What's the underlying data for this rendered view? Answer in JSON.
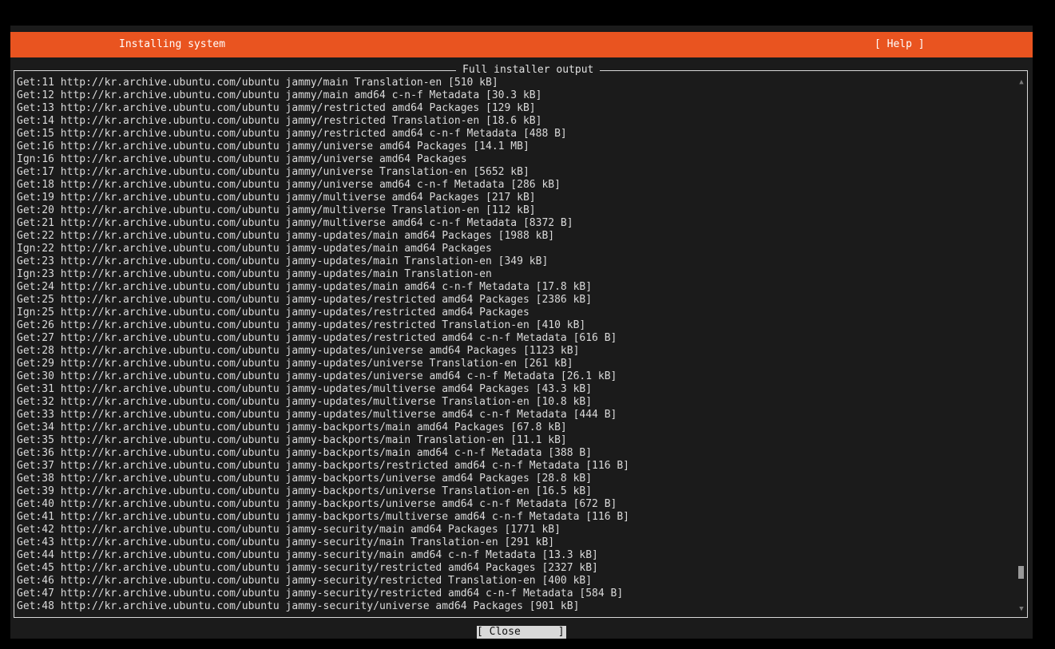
{
  "header": {
    "title": "Installing system",
    "help_label": "[ Help ]"
  },
  "output_panel": {
    "title": "Full installer output",
    "lines": [
      "Get:11 http://kr.archive.ubuntu.com/ubuntu jammy/main Translation-en [510 kB]",
      "Get:12 http://kr.archive.ubuntu.com/ubuntu jammy/main amd64 c-n-f Metadata [30.3 kB]",
      "Get:13 http://kr.archive.ubuntu.com/ubuntu jammy/restricted amd64 Packages [129 kB]",
      "Get:14 http://kr.archive.ubuntu.com/ubuntu jammy/restricted Translation-en [18.6 kB]",
      "Get:15 http://kr.archive.ubuntu.com/ubuntu jammy/restricted amd64 c-n-f Metadata [488 B]",
      "Get:16 http://kr.archive.ubuntu.com/ubuntu jammy/universe amd64 Packages [14.1 MB]",
      "Ign:16 http://kr.archive.ubuntu.com/ubuntu jammy/universe amd64 Packages",
      "Get:17 http://kr.archive.ubuntu.com/ubuntu jammy/universe Translation-en [5652 kB]",
      "Get:18 http://kr.archive.ubuntu.com/ubuntu jammy/universe amd64 c-n-f Metadata [286 kB]",
      "Get:19 http://kr.archive.ubuntu.com/ubuntu jammy/multiverse amd64 Packages [217 kB]",
      "Get:20 http://kr.archive.ubuntu.com/ubuntu jammy/multiverse Translation-en [112 kB]",
      "Get:21 http://kr.archive.ubuntu.com/ubuntu jammy/multiverse amd64 c-n-f Metadata [8372 B]",
      "Get:22 http://kr.archive.ubuntu.com/ubuntu jammy-updates/main amd64 Packages [1988 kB]",
      "Ign:22 http://kr.archive.ubuntu.com/ubuntu jammy-updates/main amd64 Packages",
      "Get:23 http://kr.archive.ubuntu.com/ubuntu jammy-updates/main Translation-en [349 kB]",
      "Ign:23 http://kr.archive.ubuntu.com/ubuntu jammy-updates/main Translation-en",
      "Get:24 http://kr.archive.ubuntu.com/ubuntu jammy-updates/main amd64 c-n-f Metadata [17.8 kB]",
      "Get:25 http://kr.archive.ubuntu.com/ubuntu jammy-updates/restricted amd64 Packages [2386 kB]",
      "Ign:25 http://kr.archive.ubuntu.com/ubuntu jammy-updates/restricted amd64 Packages",
      "Get:26 http://kr.archive.ubuntu.com/ubuntu jammy-updates/restricted Translation-en [410 kB]",
      "Get:27 http://kr.archive.ubuntu.com/ubuntu jammy-updates/restricted amd64 c-n-f Metadata [616 B]",
      "Get:28 http://kr.archive.ubuntu.com/ubuntu jammy-updates/universe amd64 Packages [1123 kB]",
      "Get:29 http://kr.archive.ubuntu.com/ubuntu jammy-updates/universe Translation-en [261 kB]",
      "Get:30 http://kr.archive.ubuntu.com/ubuntu jammy-updates/universe amd64 c-n-f Metadata [26.1 kB]",
      "Get:31 http://kr.archive.ubuntu.com/ubuntu jammy-updates/multiverse amd64 Packages [43.3 kB]",
      "Get:32 http://kr.archive.ubuntu.com/ubuntu jammy-updates/multiverse Translation-en [10.8 kB]",
      "Get:33 http://kr.archive.ubuntu.com/ubuntu jammy-updates/multiverse amd64 c-n-f Metadata [444 B]",
      "Get:34 http://kr.archive.ubuntu.com/ubuntu jammy-backports/main amd64 Packages [67.8 kB]",
      "Get:35 http://kr.archive.ubuntu.com/ubuntu jammy-backports/main Translation-en [11.1 kB]",
      "Get:36 http://kr.archive.ubuntu.com/ubuntu jammy-backports/main amd64 c-n-f Metadata [388 B]",
      "Get:37 http://kr.archive.ubuntu.com/ubuntu jammy-backports/restricted amd64 c-n-f Metadata [116 B]",
      "Get:38 http://kr.archive.ubuntu.com/ubuntu jammy-backports/universe amd64 Packages [28.8 kB]",
      "Get:39 http://kr.archive.ubuntu.com/ubuntu jammy-backports/universe Translation-en [16.5 kB]",
      "Get:40 http://kr.archive.ubuntu.com/ubuntu jammy-backports/universe amd64 c-n-f Metadata [672 B]",
      "Get:41 http://kr.archive.ubuntu.com/ubuntu jammy-backports/multiverse amd64 c-n-f Metadata [116 B]",
      "Get:42 http://kr.archive.ubuntu.com/ubuntu jammy-security/main amd64 Packages [1771 kB]",
      "Get:43 http://kr.archive.ubuntu.com/ubuntu jammy-security/main Translation-en [291 kB]",
      "Get:44 http://kr.archive.ubuntu.com/ubuntu jammy-security/main amd64 c-n-f Metadata [13.3 kB]",
      "Get:45 http://kr.archive.ubuntu.com/ubuntu jammy-security/restricted amd64 Packages [2327 kB]",
      "Get:46 http://kr.archive.ubuntu.com/ubuntu jammy-security/restricted Translation-en [400 kB]",
      "Get:47 http://kr.archive.ubuntu.com/ubuntu jammy-security/restricted amd64 c-n-f Metadata [584 B]",
      "Get:48 http://kr.archive.ubuntu.com/ubuntu jammy-security/universe amd64 Packages [901 kB]"
    ],
    "scroll_up_glyph": "▲",
    "scroll_down_glyph": "▼",
    "scroll_position": 0.95
  },
  "footer": {
    "close_label": "[ Close      ]"
  },
  "colors": {
    "accent": "#e95420",
    "background": "#1b1b1b",
    "text": "#dadada"
  }
}
